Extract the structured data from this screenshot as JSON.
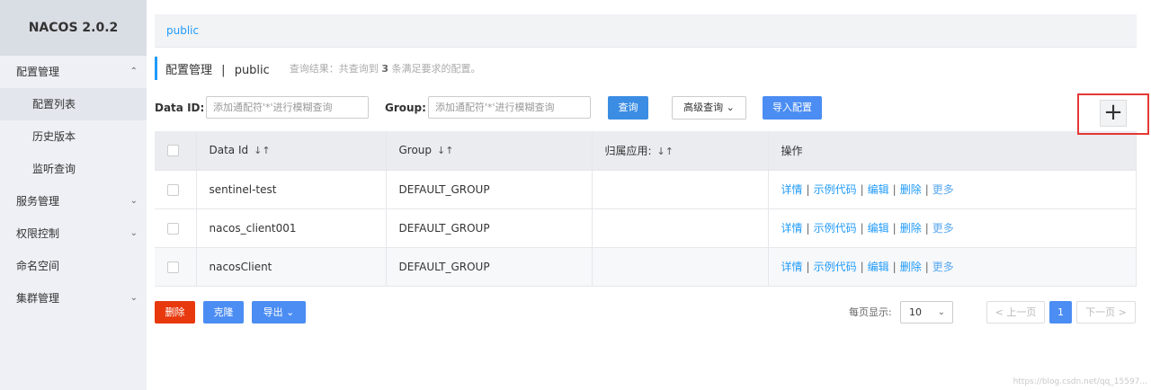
{
  "app": {
    "title": "NACOS 2.0.2"
  },
  "sidebar": {
    "items": [
      {
        "label": "配置管理",
        "chevron": "^"
      },
      {
        "label": "配置列表"
      },
      {
        "label": "历史版本"
      },
      {
        "label": "监听查询"
      },
      {
        "label": "服务管理",
        "chevron": "v"
      },
      {
        "label": "权限控制",
        "chevron": "v"
      },
      {
        "label": "命名空间"
      },
      {
        "label": "集群管理",
        "chevron": "v"
      }
    ]
  },
  "namespace_bar": {
    "label": "public"
  },
  "header": {
    "title": "配置管理",
    "separator": "|",
    "namespace": "public",
    "result_prefix": "查询结果：共查询到",
    "result_count": "3",
    "result_suffix": "条满足要求的配置。"
  },
  "search": {
    "data_id_label": "Data ID:",
    "data_id_placeholder": "添加通配符'*'进行模糊查询",
    "group_label": "Group:",
    "group_placeholder": "添加通配符'*'进行模糊查询",
    "query_button": "查询",
    "advanced_button": "高级查询",
    "import_button": "导入配置"
  },
  "add_button": {
    "label": "+"
  },
  "table": {
    "columns": [
      "Data Id",
      "Group",
      "归属应用:",
      "操作"
    ],
    "sort_icon": "↓↑",
    "rows": [
      {
        "data_id": "sentinel-test",
        "group": "DEFAULT_GROUP",
        "app": ""
      },
      {
        "data_id": "nacos_client001",
        "group": "DEFAULT_GROUP",
        "app": ""
      },
      {
        "data_id": "nacosClient",
        "group": "DEFAULT_GROUP",
        "app": ""
      }
    ],
    "actions": {
      "detail": "详情",
      "sample": "示例代码",
      "edit": "编辑",
      "delete": "删除",
      "more": "更多"
    }
  },
  "footer": {
    "delete_button": "删除",
    "clone_button": "克隆",
    "export_button": "导出",
    "page_size_label": "每页显示:",
    "page_size": "10",
    "prev": "< 上一页",
    "current_page": "1",
    "next": "下一页 >"
  },
  "watermark": "https://blog.csdn.net/qq_15597..."
}
